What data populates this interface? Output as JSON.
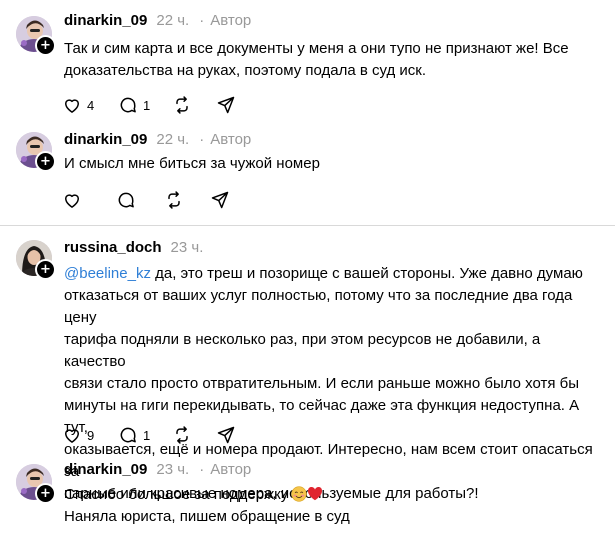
{
  "thread": [
    {
      "username": "dinarkin_09",
      "time": "22 ч.",
      "badge": "Автор",
      "lines": [
        "Так и сим карта и все документы у меня а они тупо не признают же! Все",
        "доказательства на руках, поэтому подала в суд иск."
      ],
      "likes": "4",
      "replies": "1"
    },
    {
      "username": "dinarkin_09",
      "time": "22 ч.",
      "badge": "Автор",
      "lines": [
        "И смысл мне биться за чужой номер"
      ],
      "likes": "",
      "replies": ""
    },
    {
      "username": "russina_doch",
      "time": "23 ч.",
      "mention": "@beeline_kz",
      "lines": [
        " да, это треш и позорище с вашей стороны. Уже давно думаю",
        "отказаться от ваших услуг полностью, потому что за последние два года цену",
        "тарифа подняли в несколько раз, при этом ресурсов не добавили, а качество",
        "связи стало просто отвратительным. И если раньше можно было хотя бы",
        "минуты на гиги перекидывать, то сейчас даже эта функция недоступна. А тут,",
        "оказывается, ещё и номера продают. Интересно, нам всем стоит опасаться за",
        "парные или красивые номера, используемые для работы?!"
      ],
      "likes": "9",
      "replies": "1"
    },
    {
      "username": "dinarkin_09",
      "time": "23 ч.",
      "badge": "Автор",
      "lines": [
        "Спасибо большое за поддержку",
        "Наняла юриста, пишем обращение в суд"
      ],
      "emojis": [
        "smiling-face-emoji",
        "red-heart-emoji"
      ]
    }
  ],
  "icons": {
    "like": "heart-icon",
    "reply": "speech-bubble-icon",
    "repost": "repost-icon",
    "share": "paper-plane-icon",
    "follow": "plus-icon"
  },
  "colors": {
    "mention": "#2f7fd6",
    "muted": "#999999",
    "divider": "#d9d9d9"
  }
}
